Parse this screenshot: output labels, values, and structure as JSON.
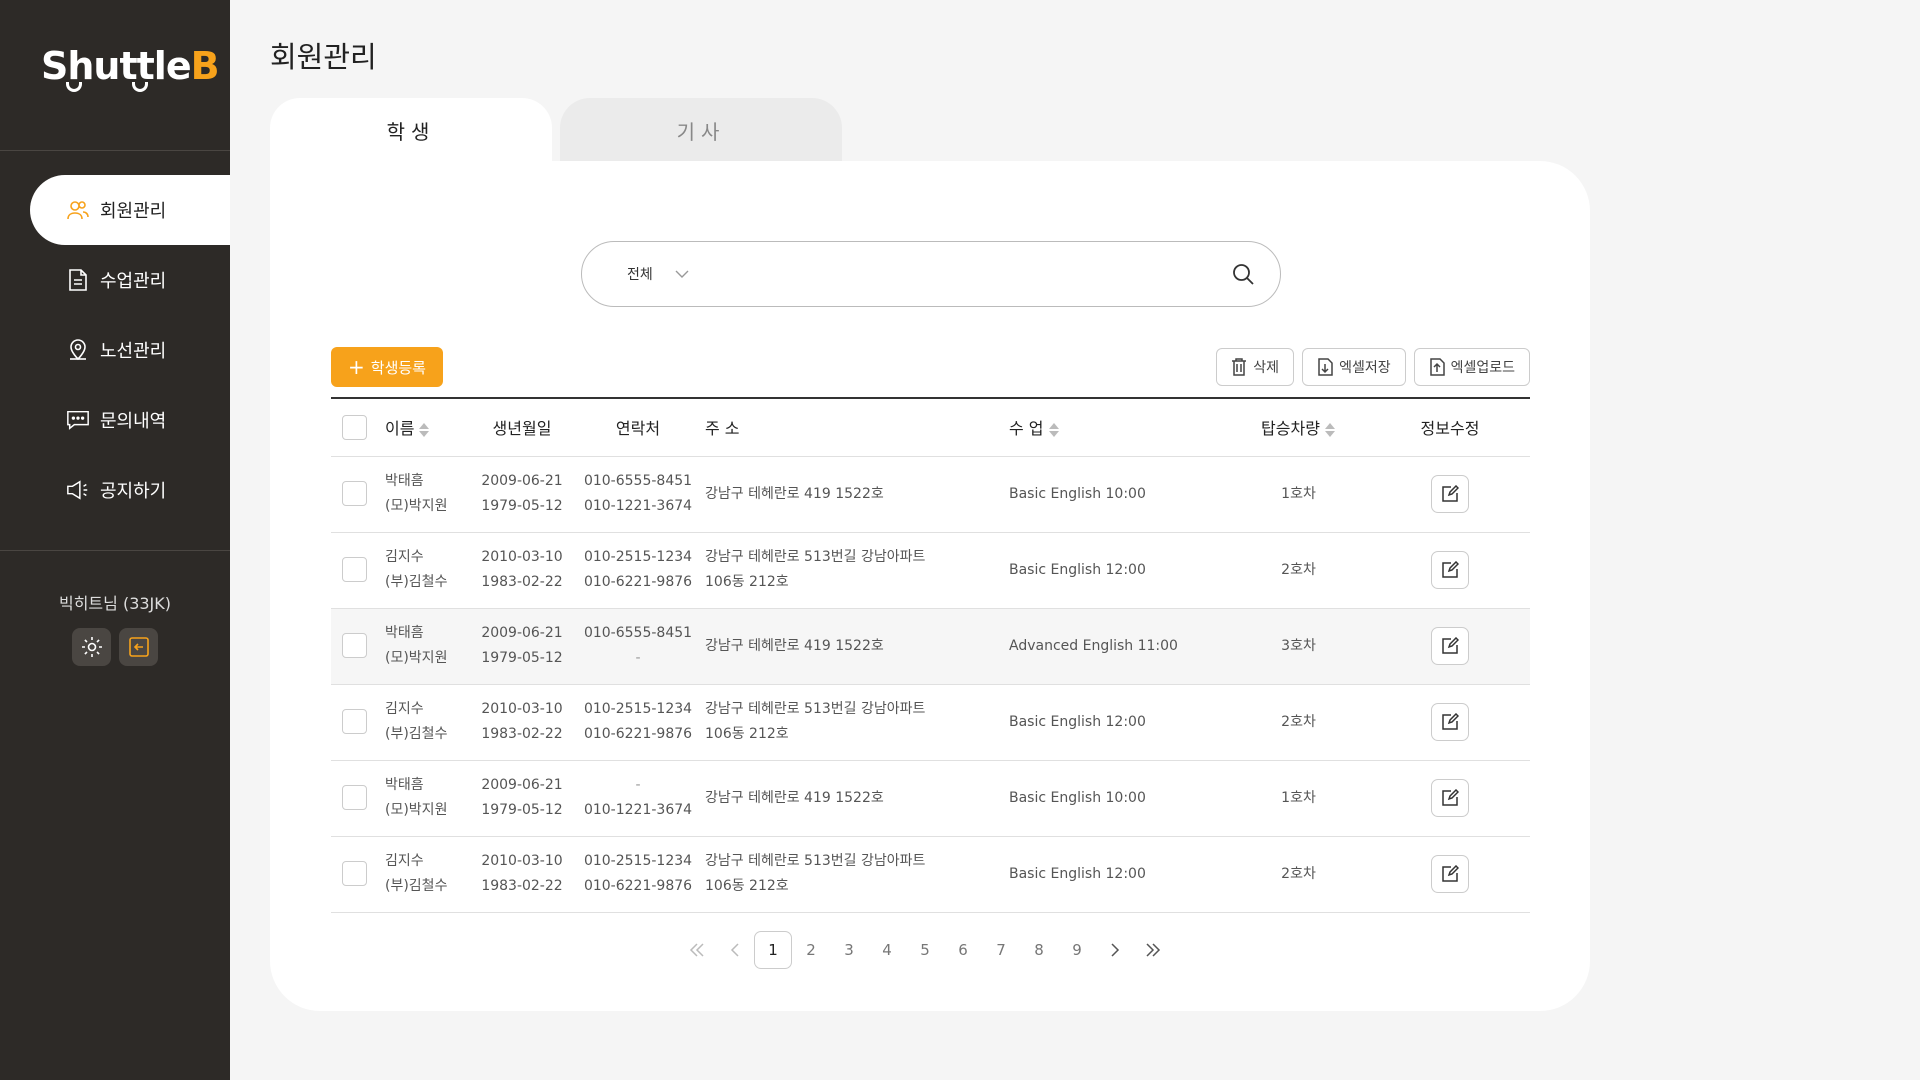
{
  "brand": {
    "logo_main": "Shuttle",
    "logo_accent": "B"
  },
  "sidebar": {
    "items": [
      {
        "label": "회원관리",
        "icon": "users-icon",
        "active": true
      },
      {
        "label": "수업관리",
        "icon": "document-icon",
        "active": false
      },
      {
        "label": "노선관리",
        "icon": "location-pin-icon",
        "active": false
      },
      {
        "label": "문의내역",
        "icon": "chat-icon",
        "active": false
      },
      {
        "label": "공지하기",
        "icon": "megaphone-icon",
        "active": false
      }
    ],
    "user": {
      "name": "빅히트님 (33JK)"
    }
  },
  "page": {
    "title": "회원관리"
  },
  "tabs": {
    "student": "학생",
    "driver": "기사"
  },
  "search": {
    "filter_label": "전체",
    "placeholder": ""
  },
  "toolbar": {
    "add_label": "학생등록",
    "delete_label": "삭제",
    "excel_save_label": "엑셀저장",
    "excel_upload_label": "엑셀업로드"
  },
  "table": {
    "headers": {
      "name": "이름",
      "birth": "생년월일",
      "contact": "연락처",
      "address": "주 소",
      "class": "수 업",
      "vehicle": "탑승차량",
      "edit": "정보수정"
    },
    "rows": [
      {
        "name": "박태흠",
        "guardian": "(모)박지원",
        "birth1": "2009-06-21",
        "birth2": "1979-05-12",
        "phone1": "010-6555-8451",
        "phone2": "010-1221-3674",
        "addr1": "강남구 테헤란로 419 1522호",
        "addr2": "",
        "class": "Basic English 10:00",
        "vehicle": "1호차"
      },
      {
        "name": "김지수",
        "guardian": "(부)김철수",
        "birth1": "2010-03-10",
        "birth2": "1983-02-22",
        "phone1": "010-2515-1234",
        "phone2": "010-6221-9876",
        "addr1": "강남구 테헤란로 513번길 강남아파트",
        "addr2": "106동 212호",
        "class": "Basic English 12:00",
        "vehicle": "2호차"
      },
      {
        "name": "박태흠",
        "guardian": "(모)박지원",
        "birth1": "2009-06-21",
        "birth2": "1979-05-12",
        "phone1": "010-6555-8451",
        "phone2": "-",
        "addr1": "강남구 테헤란로 419 1522호",
        "addr2": "",
        "class": "Advanced English 11:00",
        "vehicle": "3호차"
      },
      {
        "name": "김지수",
        "guardian": "(부)김철수",
        "birth1": "2010-03-10",
        "birth2": "1983-02-22",
        "phone1": "010-2515-1234",
        "phone2": "010-6221-9876",
        "addr1": "강남구 테헤란로 513번길 강남아파트",
        "addr2": "106동 212호",
        "class": "Basic English 12:00",
        "vehicle": "2호차"
      },
      {
        "name": "박태흠",
        "guardian": "(모)박지원",
        "birth1": "2009-06-21",
        "birth2": "1979-05-12",
        "phone1": "-",
        "phone2": "010-1221-3674",
        "addr1": "강남구 테헤란로 419 1522호",
        "addr2": "",
        "class": "Basic English 10:00",
        "vehicle": "1호차"
      },
      {
        "name": "김지수",
        "guardian": "(부)김철수",
        "birth1": "2010-03-10",
        "birth2": "1983-02-22",
        "phone1": "010-2515-1234",
        "phone2": "010-6221-9876",
        "addr1": "강남구 테헤란로 513번길 강남아파트",
        "addr2": "106동 212호",
        "class": "Basic English 12:00",
        "vehicle": "2호차"
      }
    ]
  },
  "pagination": {
    "pages": [
      "1",
      "2",
      "3",
      "4",
      "5",
      "6",
      "7",
      "8",
      "9"
    ],
    "current": "1"
  },
  "colors": {
    "accent": "#f7a21b",
    "sidebar_bg": "#2d2a27"
  }
}
